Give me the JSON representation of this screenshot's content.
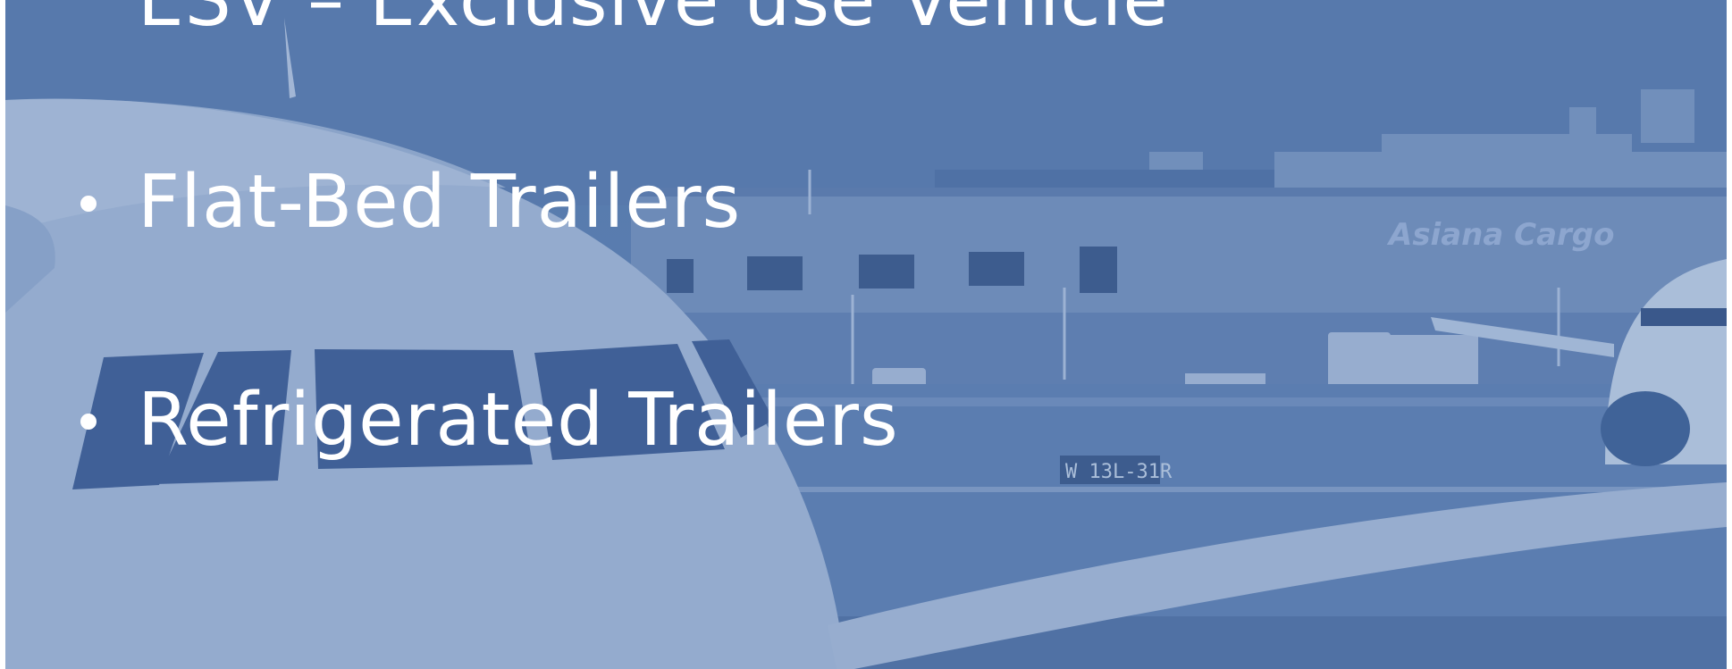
{
  "slide": {
    "bullets": [
      {
        "text": "ESV – Exclusive use Vehicle"
      },
      {
        "text": "Flat-Bed Trailers"
      },
      {
        "text": "Refrigerated Trailers"
      }
    ],
    "photo": {
      "building_sign": "Asiana Cargo",
      "runway_sign": "W 13L-31R"
    }
  },
  "colors": {
    "tint": "#5a7db0",
    "text": "#ffffff"
  }
}
